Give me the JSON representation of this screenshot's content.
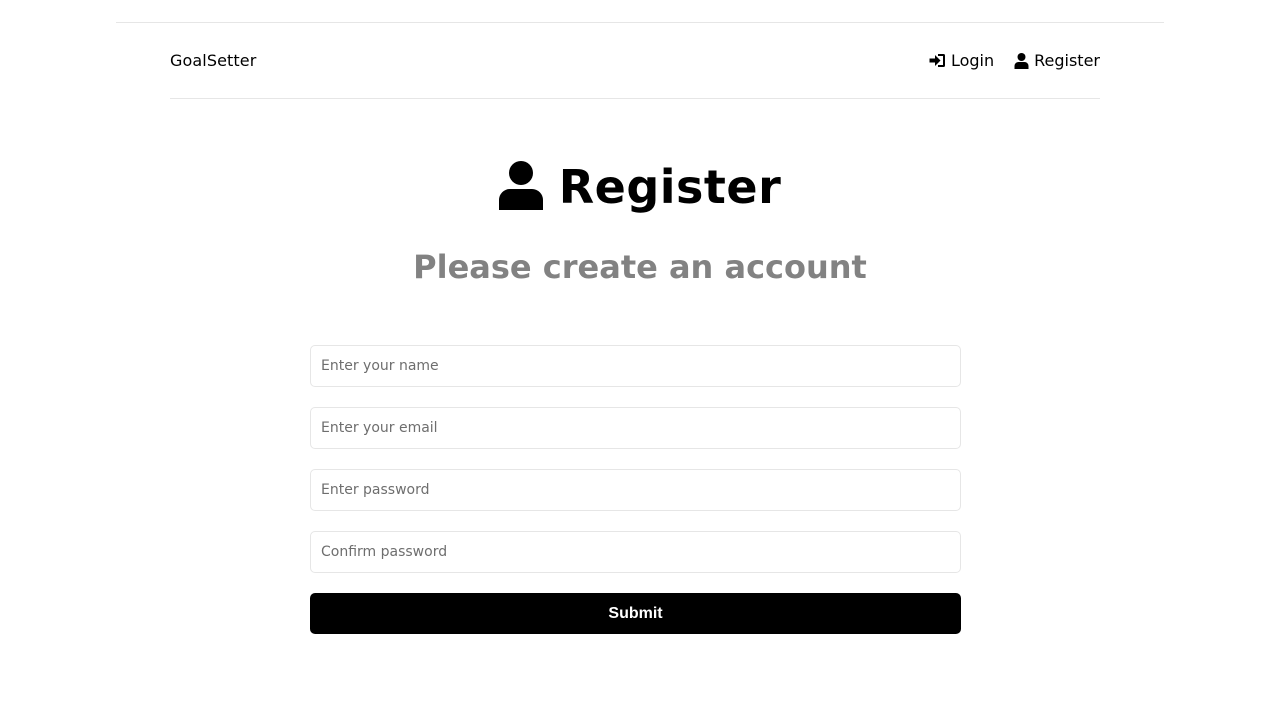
{
  "header": {
    "logo": "GoalSetter",
    "nav": [
      {
        "label": "Login",
        "icon": "sign-in-icon"
      },
      {
        "label": "Register",
        "icon": "user-icon"
      }
    ]
  },
  "heading": {
    "title": "Register",
    "icon": "user-icon",
    "subtitle": "Please create an account"
  },
  "form": {
    "name_placeholder": "Enter your name",
    "email_placeholder": "Enter your email",
    "password_placeholder": "Enter password",
    "confirm_placeholder": "Confirm password",
    "submit_label": "Submit"
  },
  "colors": {
    "background": "#ffffff",
    "subtitle": "#828282",
    "button": "#000000",
    "border": "#e6e6e6"
  }
}
